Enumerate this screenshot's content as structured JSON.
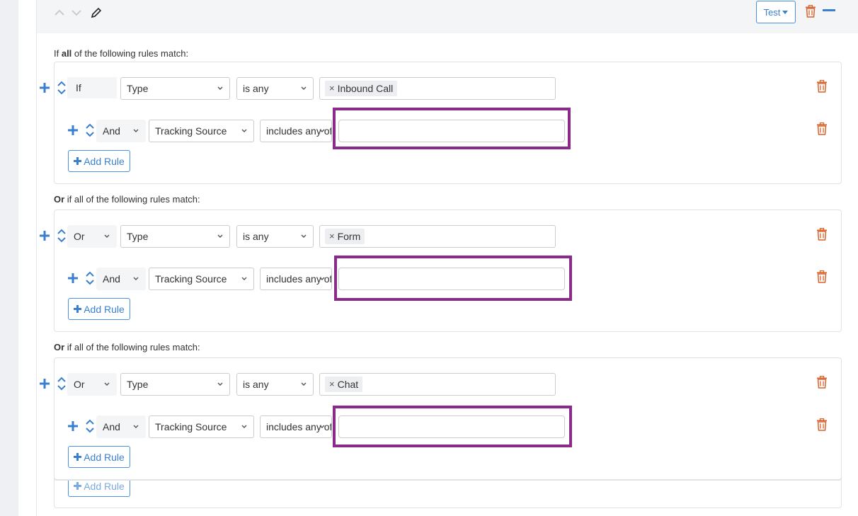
{
  "header": {
    "test_label": "Test"
  },
  "groups": [
    {
      "label_prefix": "If ",
      "label_bold": "all",
      "label_suffix": " of the following rules match:",
      "first": {
        "connector": "If",
        "field": "Type",
        "operator": "is any",
        "tag": "Inbound Call"
      },
      "second": {
        "connector": "And",
        "field": "Tracking Source",
        "operator": "includes any of",
        "value": ""
      },
      "add_rule": "Add Rule"
    },
    {
      "label_bold": "Or",
      "label_suffix": " if all of the following rules match:",
      "first": {
        "connector": "Or",
        "field": "Type",
        "operator": "is any",
        "tag": "Form"
      },
      "second": {
        "connector": "And",
        "field": "Tracking Source",
        "operator": "includes any of",
        "value": ""
      },
      "add_rule": "Add Rule"
    },
    {
      "label_bold": "Or",
      "label_suffix": " if all of the following rules match:",
      "first": {
        "connector": "Or",
        "field": "Type",
        "operator": "is any",
        "tag": "Chat"
      },
      "second": {
        "connector": "And",
        "field": "Tracking Source",
        "operator": "includes any of",
        "value": ""
      },
      "add_rule": "Add Rule"
    }
  ],
  "bottom_add_rule": "Add Rule",
  "colors": {
    "accent": "#3a7fcf",
    "danger": "#d9622b",
    "highlight": "#8b2a8b"
  }
}
